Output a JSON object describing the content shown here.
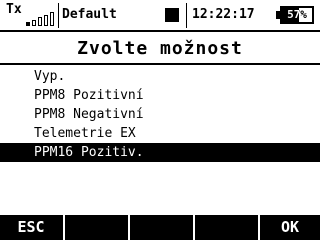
{
  "status_bar": {
    "tx_label": "Tx",
    "signal_bars_total": 5,
    "signal_bars_filled": 1,
    "model_name": "Default",
    "time": "12:22:17",
    "battery_text": "57%",
    "battery_level": 0.57
  },
  "screen_title": "Zvolte možnost",
  "menu": {
    "items": [
      {
        "label": "Vyp."
      },
      {
        "label": "PPM8 Pozitivní"
      },
      {
        "label": "PPM8 Negativní"
      },
      {
        "label": "Telemetrie EX"
      },
      {
        "label": "PPM16 Pozitiv."
      }
    ],
    "selected_index": 4
  },
  "softkeys": {
    "left": "ESC",
    "right": "OK"
  }
}
